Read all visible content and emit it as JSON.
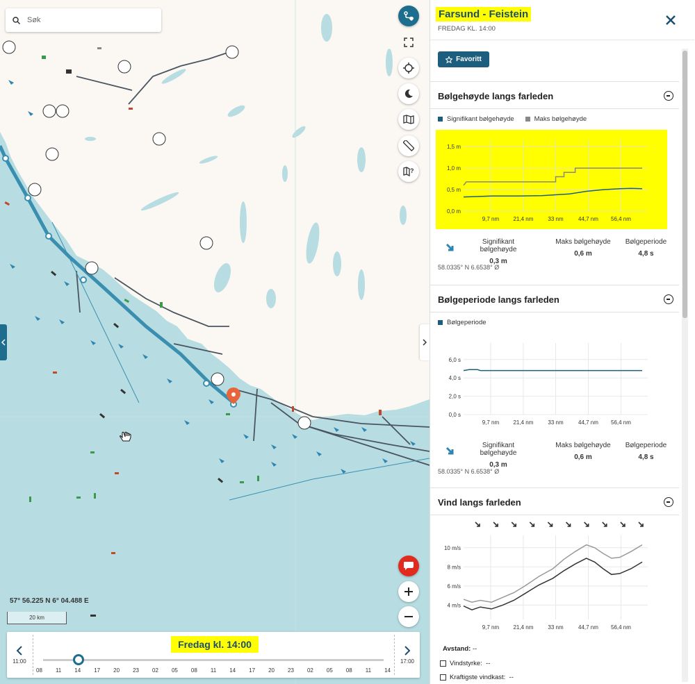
{
  "search": {
    "placeholder": "Søk"
  },
  "map": {
    "coordinates": "57° 56.225 N 6° 04.488 E",
    "scale": "20 km",
    "colors": {
      "sea": "#b7dde2",
      "land": "#fbf7f2",
      "route": "#3a8fb0",
      "accent": "#1d6e8e"
    }
  },
  "map_tools": [
    "route-icon",
    "fullscreen-icon",
    "locate-icon",
    "night-mode-icon",
    "map-layers-icon",
    "ruler-icon",
    "map-info-icon",
    "chat-icon",
    "zoom-in-icon",
    "zoom-out-icon"
  ],
  "timeline": {
    "current": "Fredag kl. 14:00",
    "start": "11:00",
    "end": "17:00",
    "ticks": [
      "08",
      "11",
      "14",
      "17",
      "20",
      "23",
      "02",
      "05",
      "08",
      "11",
      "14",
      "17",
      "20",
      "23",
      "02",
      "05",
      "08",
      "11",
      "14"
    ],
    "position": 0.105
  },
  "panel": {
    "title": "Farsund - Feistein",
    "subtitle": "FREDAG KL. 14:00",
    "favorite_label": "Favoritt"
  },
  "wave_height": {
    "title": "Bølgehøyde langs farleden",
    "legend": [
      "Signifikant bølgehøyde",
      "Maks bølgehøyde"
    ],
    "stats": [
      {
        "label": "Signifikant bølgehøyde",
        "value": "0,3 m"
      },
      {
        "label": "Maks bølgehøyde",
        "value": "0,6 m"
      },
      {
        "label": "Bølgeperiode",
        "value": "4,8 s"
      }
    ],
    "position": "58.0335° N 6.6538° Ø"
  },
  "wave_period": {
    "title": "Bølgeperiode langs farleden",
    "legend": [
      "Bølgeperiode"
    ],
    "stats": [
      {
        "label": "Signifikant bølgehøyde",
        "value": "0,3 m"
      },
      {
        "label": "Maks bølgehøyde",
        "value": "0,6 m"
      },
      {
        "label": "Bølgeperiode",
        "value": "4,8 s"
      }
    ],
    "position": "58.0335° N 6.6538° Ø"
  },
  "wind": {
    "title": "Vind langs farleden",
    "distance_label": "Avstand:",
    "distance_value": "--",
    "wind_speed_label": "Vindstyrke:",
    "wind_speed_value": "--",
    "gust_label": "Kraftigste vindkast:",
    "gust_value": "--"
  },
  "chart_data": [
    {
      "type": "line",
      "xlabel_ticks": [
        "9,7 nm",
        "21,4 nm",
        "33 nm",
        "44,7 nm",
        "56,4 nm"
      ],
      "x_ticks": [
        9.7,
        21.4,
        33,
        44.7,
        56.4
      ],
      "xlim": [
        0,
        66
      ],
      "ylim": [
        0,
        1.6
      ],
      "yticks": [
        0,
        0.5,
        1.0,
        1.5
      ],
      "ytick_labels": [
        "0,0 m",
        "0,5 m",
        "1,0 m",
        "1,5 m"
      ],
      "grid": true,
      "series": [
        {
          "name": "Signifikant bølgehøyde",
          "color": "#1d5e7e",
          "x": [
            0,
            5,
            10,
            20,
            28,
            33,
            38,
            44,
            50,
            56,
            60,
            64
          ],
          "y": [
            0.33,
            0.34,
            0.35,
            0.35,
            0.36,
            0.38,
            0.4,
            0.46,
            0.5,
            0.52,
            0.53,
            0.52
          ]
        },
        {
          "name": "Maks bølgehøyde",
          "color": "#888888",
          "x": [
            0,
            1,
            28,
            28,
            33,
            33,
            36,
            36,
            40,
            40,
            64
          ],
          "y": [
            0.6,
            0.68,
            0.68,
            0.68,
            0.68,
            0.8,
            0.8,
            0.9,
            0.9,
            1.0,
            1.0
          ]
        }
      ]
    },
    {
      "type": "line",
      "xlabel_ticks": [
        "9,7 nm",
        "21,4 nm",
        "33 nm",
        "44,7 nm",
        "56,4 nm"
      ],
      "x_ticks": [
        9.7,
        21.4,
        33,
        44.7,
        56.4
      ],
      "xlim": [
        0,
        66
      ],
      "ylim": [
        0,
        7.5
      ],
      "yticks": [
        0,
        2,
        4,
        6
      ],
      "ytick_labels": [
        "0,0 s",
        "2,0 s",
        "4,0 s",
        "6,0 s"
      ],
      "grid": true,
      "series": [
        {
          "name": "Bølgeperiode",
          "color": "#1d5e7e",
          "x": [
            0,
            2,
            5,
            6,
            64
          ],
          "y": [
            4.8,
            4.9,
            4.9,
            4.8,
            4.8
          ]
        }
      ]
    },
    {
      "type": "line",
      "xlabel_ticks": [
        "9,7 nm",
        "21,4 nm",
        "33 nm",
        "44,7 nm",
        "56,4 nm"
      ],
      "x_ticks": [
        9.7,
        21.4,
        33,
        44.7,
        56.4
      ],
      "xlim": [
        0,
        66
      ],
      "ylim": [
        2.5,
        11
      ],
      "yticks": [
        4,
        6,
        8,
        10
      ],
      "ytick_labels": [
        "4 m/s",
        "6 m/s",
        "8 m/s",
        "10 m/s"
      ],
      "grid": true,
      "series": [
        {
          "name": "",
          "color": "#999999",
          "x": [
            0,
            3,
            6,
            10,
            14,
            18,
            22,
            27,
            32,
            36,
            40,
            44,
            47,
            50,
            53,
            56,
            60,
            64
          ],
          "y": [
            4.6,
            4.3,
            4.5,
            4.3,
            4.8,
            5.3,
            6.0,
            7.0,
            7.8,
            8.8,
            9.6,
            10.3,
            10.0,
            9.4,
            8.9,
            9.0,
            9.6,
            10.3
          ]
        },
        {
          "name": "",
          "color": "#333333",
          "x": [
            0,
            3,
            6,
            10,
            14,
            18,
            22,
            27,
            32,
            36,
            40,
            44,
            47,
            50,
            53,
            56,
            60,
            64
          ],
          "y": [
            3.9,
            3.5,
            3.8,
            3.6,
            4.0,
            4.5,
            5.2,
            6.1,
            6.8,
            7.6,
            8.3,
            8.9,
            8.5,
            7.8,
            7.2,
            7.3,
            7.8,
            8.5
          ]
        }
      ],
      "direction_arrows": 10
    }
  ]
}
